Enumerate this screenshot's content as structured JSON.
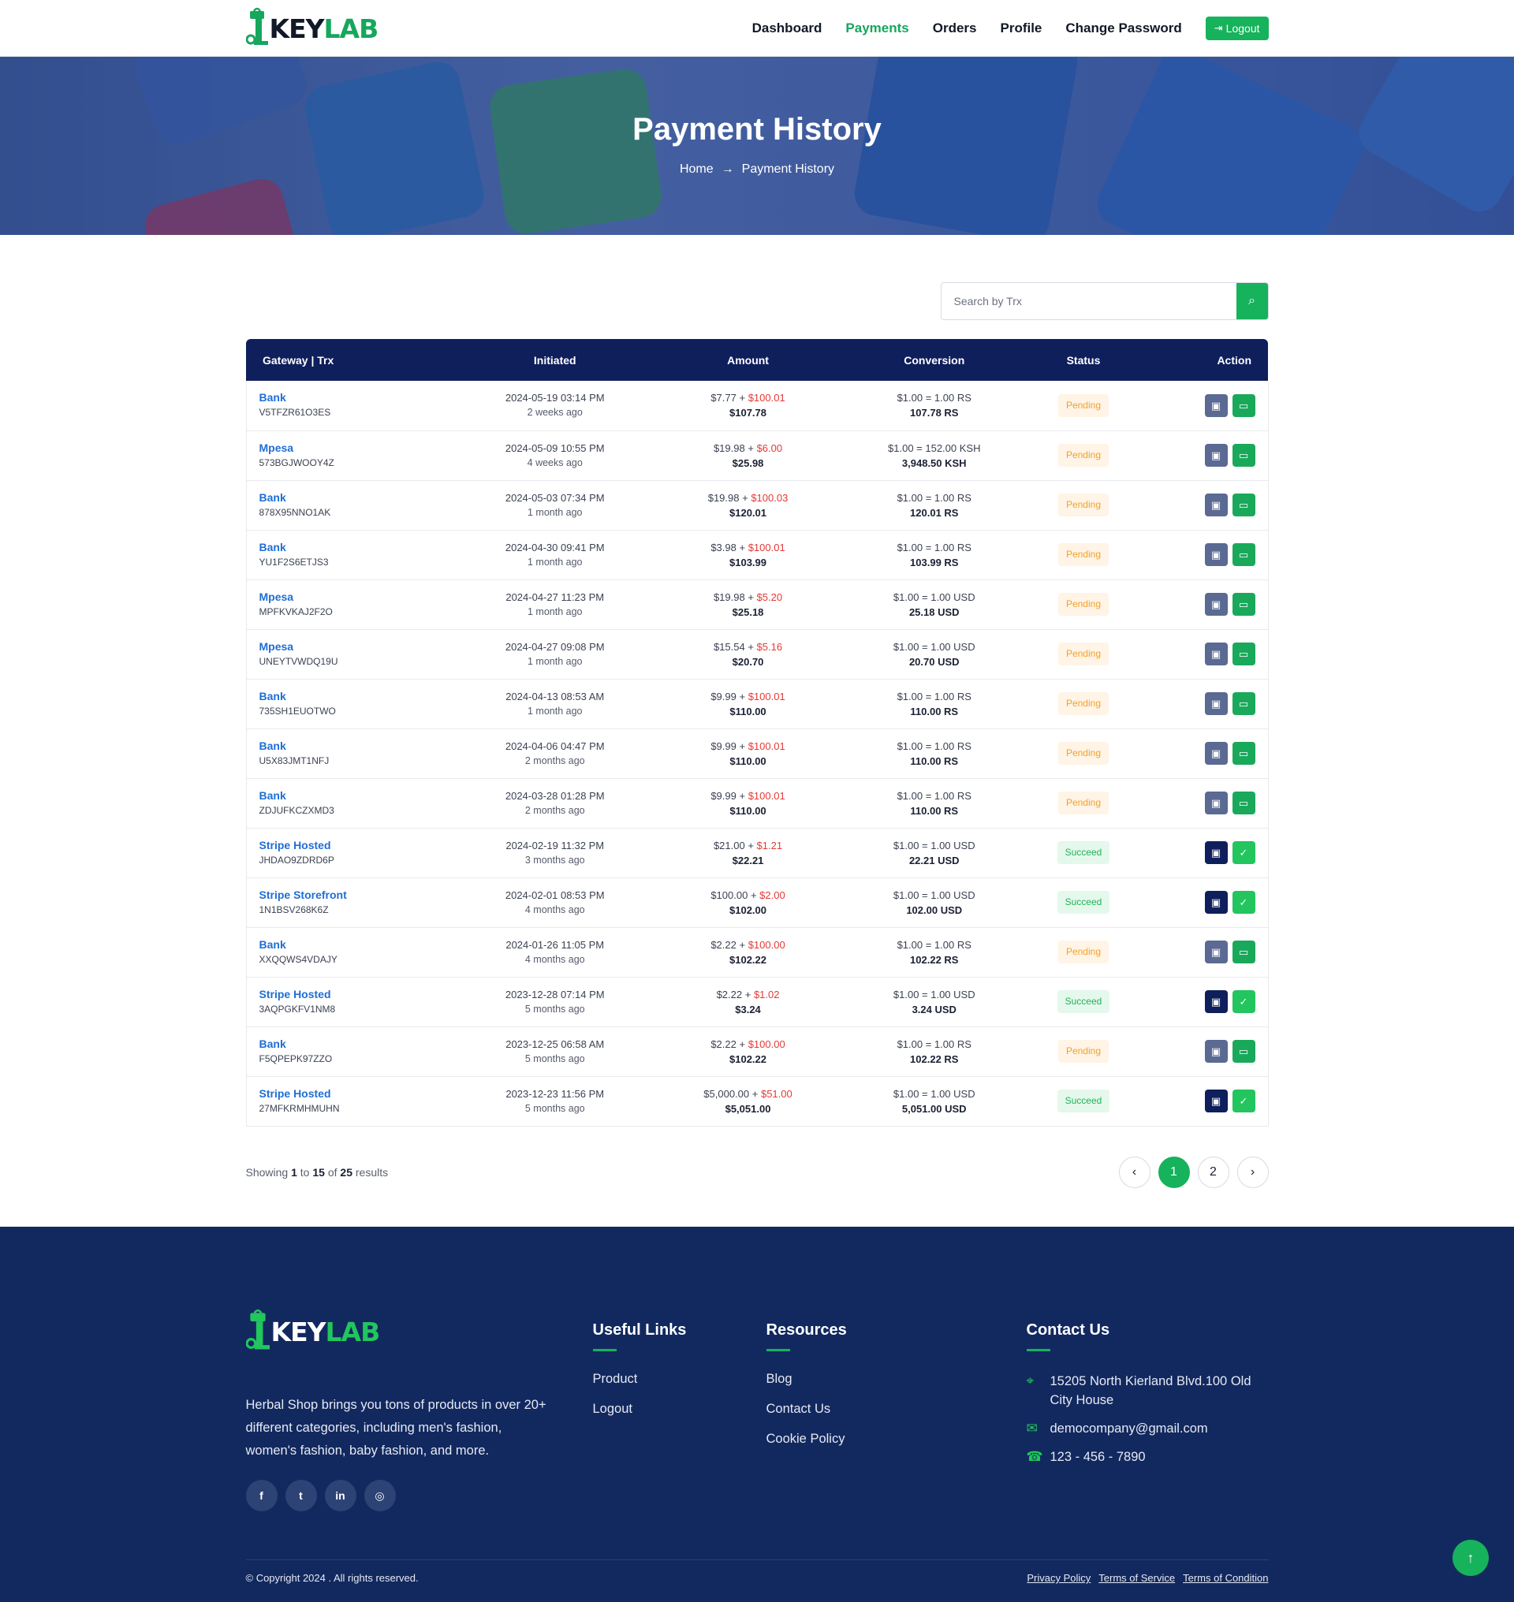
{
  "brand": {
    "name_a": "KEY",
    "name_b": "LAB",
    "color_green": "#16b25c",
    "color_navy": "#0f1f5c"
  },
  "nav": {
    "items": [
      "Dashboard",
      "Payments",
      "Orders",
      "Profile",
      "Change Password"
    ],
    "active": "Payments",
    "logout_label": "Logout"
  },
  "hero": {
    "title": "Payment History",
    "crumb_home": "Home",
    "crumb_current": "Payment History"
  },
  "search": {
    "placeholder": "Search by Trx",
    "icon": "search-icon"
  },
  "table": {
    "headers": [
      "Gateway | Trx",
      "Initiated",
      "Amount",
      "Conversion",
      "Status",
      "Action"
    ],
    "rows": [
      {
        "gateway": "Bank",
        "trx": "V5TFZR61O3ES",
        "date": "2024-05-19 03:14 PM",
        "ago": "2 weeks ago",
        "amount": "$7.77",
        "charge": "$100.01",
        "total": "$107.78",
        "rate": "$1.00 = 1.00 RS",
        "converted": "107.78 RS",
        "status": "Pending"
      },
      {
        "gateway": "Mpesa",
        "trx": "573BGJWOOY4Z",
        "date": "2024-05-09 10:55 PM",
        "ago": "4 weeks ago",
        "amount": "$19.98",
        "charge": "$6.00",
        "total": "$25.98",
        "rate": "$1.00 = 152.00 KSH",
        "converted": "3,948.50 KSH",
        "status": "Pending"
      },
      {
        "gateway": "Bank",
        "trx": "878X95NNO1AK",
        "date": "2024-05-03 07:34 PM",
        "ago": "1 month ago",
        "amount": "$19.98",
        "charge": "$100.03",
        "total": "$120.01",
        "rate": "$1.00 = 1.00 RS",
        "converted": "120.01 RS",
        "status": "Pending"
      },
      {
        "gateway": "Bank",
        "trx": "YU1F2S6ETJS3",
        "date": "2024-04-30 09:41 PM",
        "ago": "1 month ago",
        "amount": "$3.98",
        "charge": "$100.01",
        "total": "$103.99",
        "rate": "$1.00 = 1.00 RS",
        "converted": "103.99 RS",
        "status": "Pending"
      },
      {
        "gateway": "Mpesa",
        "trx": "MPFKVKAJ2F2O",
        "date": "2024-04-27 11:23 PM",
        "ago": "1 month ago",
        "amount": "$19.98",
        "charge": "$5.20",
        "total": "$25.18",
        "rate": "$1.00 = 1.00 USD",
        "converted": "25.18 USD",
        "status": "Pending"
      },
      {
        "gateway": "Mpesa",
        "trx": "UNEYTVWDQ19U",
        "date": "2024-04-27 09:08 PM",
        "ago": "1 month ago",
        "amount": "$15.54",
        "charge": "$5.16",
        "total": "$20.70",
        "rate": "$1.00 = 1.00 USD",
        "converted": "20.70 USD",
        "status": "Pending"
      },
      {
        "gateway": "Bank",
        "trx": "735SH1EUOTWO",
        "date": "2024-04-13 08:53 AM",
        "ago": "1 month ago",
        "amount": "$9.99",
        "charge": "$100.01",
        "total": "$110.00",
        "rate": "$1.00 = 1.00 RS",
        "converted": "110.00 RS",
        "status": "Pending"
      },
      {
        "gateway": "Bank",
        "trx": "U5X83JMT1NFJ",
        "date": "2024-04-06 04:47 PM",
        "ago": "2 months ago",
        "amount": "$9.99",
        "charge": "$100.01",
        "total": "$110.00",
        "rate": "$1.00 = 1.00 RS",
        "converted": "110.00 RS",
        "status": "Pending"
      },
      {
        "gateway": "Bank",
        "trx": "ZDJUFKCZXMD3",
        "date": "2024-03-28 01:28 PM",
        "ago": "2 months ago",
        "amount": "$9.99",
        "charge": "$100.01",
        "total": "$110.00",
        "rate": "$1.00 = 1.00 RS",
        "converted": "110.00 RS",
        "status": "Pending"
      },
      {
        "gateway": "Stripe Hosted",
        "trx": "JHDAO9ZDRD6P",
        "date": "2024-02-19 11:32 PM",
        "ago": "3 months ago",
        "amount": "$21.00",
        "charge": "$1.21",
        "total": "$22.21",
        "rate": "$1.00 = 1.00 USD",
        "converted": "22.21 USD",
        "status": "Succeed"
      },
      {
        "gateway": "Stripe Storefront",
        "trx": "1N1BSV268K6Z",
        "date": "2024-02-01 08:53 PM",
        "ago": "4 months ago",
        "amount": "$100.00",
        "charge": "$2.00",
        "total": "$102.00",
        "rate": "$1.00 = 1.00 USD",
        "converted": "102.00 USD",
        "status": "Succeed"
      },
      {
        "gateway": "Bank",
        "trx": "XXQQWS4VDAJY",
        "date": "2024-01-26 11:05 PM",
        "ago": "4 months ago",
        "amount": "$2.22",
        "charge": "$100.00",
        "total": "$102.22",
        "rate": "$1.00 = 1.00 RS",
        "converted": "102.22 RS",
        "status": "Pending"
      },
      {
        "gateway": "Stripe Hosted",
        "trx": "3AQPGKFV1NM8",
        "date": "2023-12-28 07:14 PM",
        "ago": "5 months ago",
        "amount": "$2.22",
        "charge": "$1.02",
        "total": "$3.24",
        "rate": "$1.00 = 1.00 USD",
        "converted": "3.24 USD",
        "status": "Succeed"
      },
      {
        "gateway": "Bank",
        "trx": "F5QPEPK97ZZO",
        "date": "2023-12-25 06:58 AM",
        "ago": "5 months ago",
        "amount": "$2.22",
        "charge": "$100.00",
        "total": "$102.22",
        "rate": "$1.00 = 1.00 RS",
        "converted": "102.22 RS",
        "status": "Pending"
      },
      {
        "gateway": "Stripe Hosted",
        "trx": "27MFKRMHMUHN",
        "date": "2023-12-23 11:56 PM",
        "ago": "5 months ago",
        "amount": "$5,000.00",
        "charge": "$51.00",
        "total": "$5,051.00",
        "rate": "$1.00 = 1.00 USD",
        "converted": "5,051.00 USD",
        "status": "Succeed"
      }
    ]
  },
  "pagination": {
    "showing_prefix": "Showing",
    "from": "1",
    "to_word": "to",
    "to": "15",
    "of_word": "of",
    "total": "25",
    "suffix": "results",
    "pages": [
      "1",
      "2"
    ],
    "current": "1",
    "prev": "‹",
    "next": "›"
  },
  "footer": {
    "description": "Herbal Shop brings you tons of products in over 20+ different categories, including men's fashion, women's fashion, baby fashion, and more.",
    "socials": [
      "facebook-icon",
      "twitter-icon",
      "linkedin-icon",
      "instagram-icon"
    ],
    "useful_links": {
      "title": "Useful Links",
      "items": [
        "Product",
        "Logout"
      ]
    },
    "resources": {
      "title": "Resources",
      "items": [
        "Blog",
        "Contact Us",
        "Cookie Policy"
      ]
    },
    "contact": {
      "title": "Contact Us",
      "address": "15205 North Kierland Blvd.100 Old City House",
      "email": "democompany@gmail.com",
      "phone": "123 - 456 - 7890"
    },
    "copyright": "© Copyright 2024 . All rights reserved.",
    "legal_links": [
      "Privacy Policy",
      "Terms of Service",
      "Terms of Condition"
    ]
  },
  "scroll_top_icon": "arrow-up-icon"
}
